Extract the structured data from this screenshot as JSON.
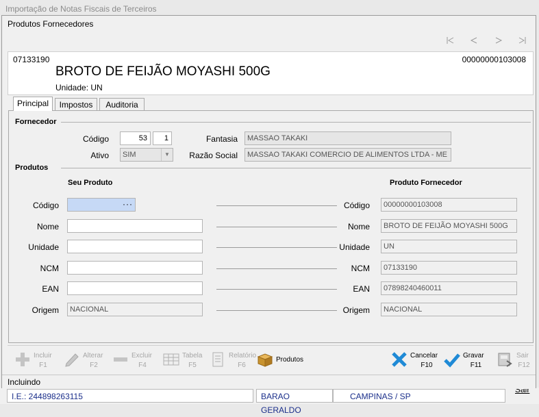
{
  "background": {
    "window_title": "Importação de Notas Fiscais de Terceiros",
    "ie": "I.E.: 244898263115",
    "district": "BARAO GERALDO",
    "city": "CAMPINAS / SP",
    "exit": "Sair"
  },
  "dialog": {
    "title": "Produtos Fornecedores",
    "nav_icons": [
      "first-record-icon",
      "prev-record-icon",
      "next-record-icon",
      "last-record-icon"
    ]
  },
  "header": {
    "ncm": "07133190",
    "reference": "00000000103008",
    "product_name": "BROTO DE FEIJÃO MOYASHI 500G",
    "unit_label": "Unidade:",
    "unit_value": "UN"
  },
  "tabs": [
    {
      "label": "Principal",
      "active": true
    },
    {
      "label": "Impostos",
      "active": false
    },
    {
      "label": "Auditoria",
      "active": false
    }
  ],
  "fornecedor": {
    "section": "Fornecedor",
    "codigo_label": "Código",
    "codigo": "53",
    "codigo_seq": "1",
    "ativo_label": "Ativo",
    "ativo": "SIM",
    "fantasia_label": "Fantasia",
    "fantasia": "MASSAO TAKAKI",
    "razao_label": "Razão Social",
    "razao": "MASSAO TAKAKI COMERCIO DE ALIMENTOS LTDA - ME"
  },
  "produtos": {
    "section": "Produtos",
    "seu_produto": "Seu Produto",
    "produto_fornecedor": "Produto Fornecedor",
    "rows": [
      {
        "label": "Código",
        "own": "",
        "supplier": "00000000103008"
      },
      {
        "label": "Nome",
        "own": "",
        "supplier": "BROTO DE FEIJÃO MOYASHI 500G"
      },
      {
        "label": "Unidade",
        "own": "",
        "supplier": "UN"
      },
      {
        "label": "NCM",
        "own": "",
        "supplier": "07133190"
      },
      {
        "label": "EAN",
        "own": "",
        "supplier": "07898240460011"
      },
      {
        "label": "Origem",
        "own": "NACIONAL",
        "supplier": "NACIONAL"
      }
    ],
    "lookup_icon": "ellipsis-icon"
  },
  "toolbar": {
    "incluir": {
      "label": "Incluir",
      "key": "F1"
    },
    "alterar": {
      "label": "Alterar",
      "key": "F2"
    },
    "excluir": {
      "label": "Excluir",
      "key": "F4"
    },
    "tabela": {
      "label": "Tabela",
      "key": "F5"
    },
    "relatorio": {
      "label": "Relatório",
      "key": "F6"
    },
    "produtos": {
      "label": "Produtos"
    },
    "cancelar": {
      "label": "Cancelar",
      "key": "F10"
    },
    "gravar": {
      "label": "Gravar",
      "key": "F11"
    },
    "sair": {
      "label": "Sair",
      "key": "F12"
    }
  },
  "status": "Incluindo"
}
